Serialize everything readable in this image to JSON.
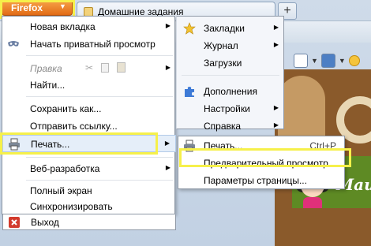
{
  "browser": {
    "firefox_button": "Firefox",
    "tab_title": "Домашние задания",
    "new_tab": "+"
  },
  "main_menu": {
    "new_tab": "Новая вкладка",
    "private": "Начать приватный просмотр",
    "edit": "Правка",
    "find": "Найти...",
    "save_as": "Сохранить как...",
    "send_link": "Отправить ссылку...",
    "print": "Печать...",
    "web_dev": "Веб-разработка",
    "fullscreen": "Полный экран",
    "sync": "Синхронизировать",
    "exit": "Выход"
  },
  "right_column": {
    "bookmarks": "Закладки",
    "history": "Журнал",
    "downloads": "Загрузки",
    "addons": "Дополнения",
    "settings": "Настройки",
    "help": "Справка"
  },
  "print_submenu": {
    "print": "Печать...",
    "print_shortcut": "Ctrl+P",
    "preview": "Предварительный просмотр",
    "page_setup": "Параметры страницы..."
  },
  "page": {
    "heading_fragment": "Маи"
  },
  "colors": {
    "highlight": "#f6f04a",
    "firefox_orange": "#e26b16"
  }
}
